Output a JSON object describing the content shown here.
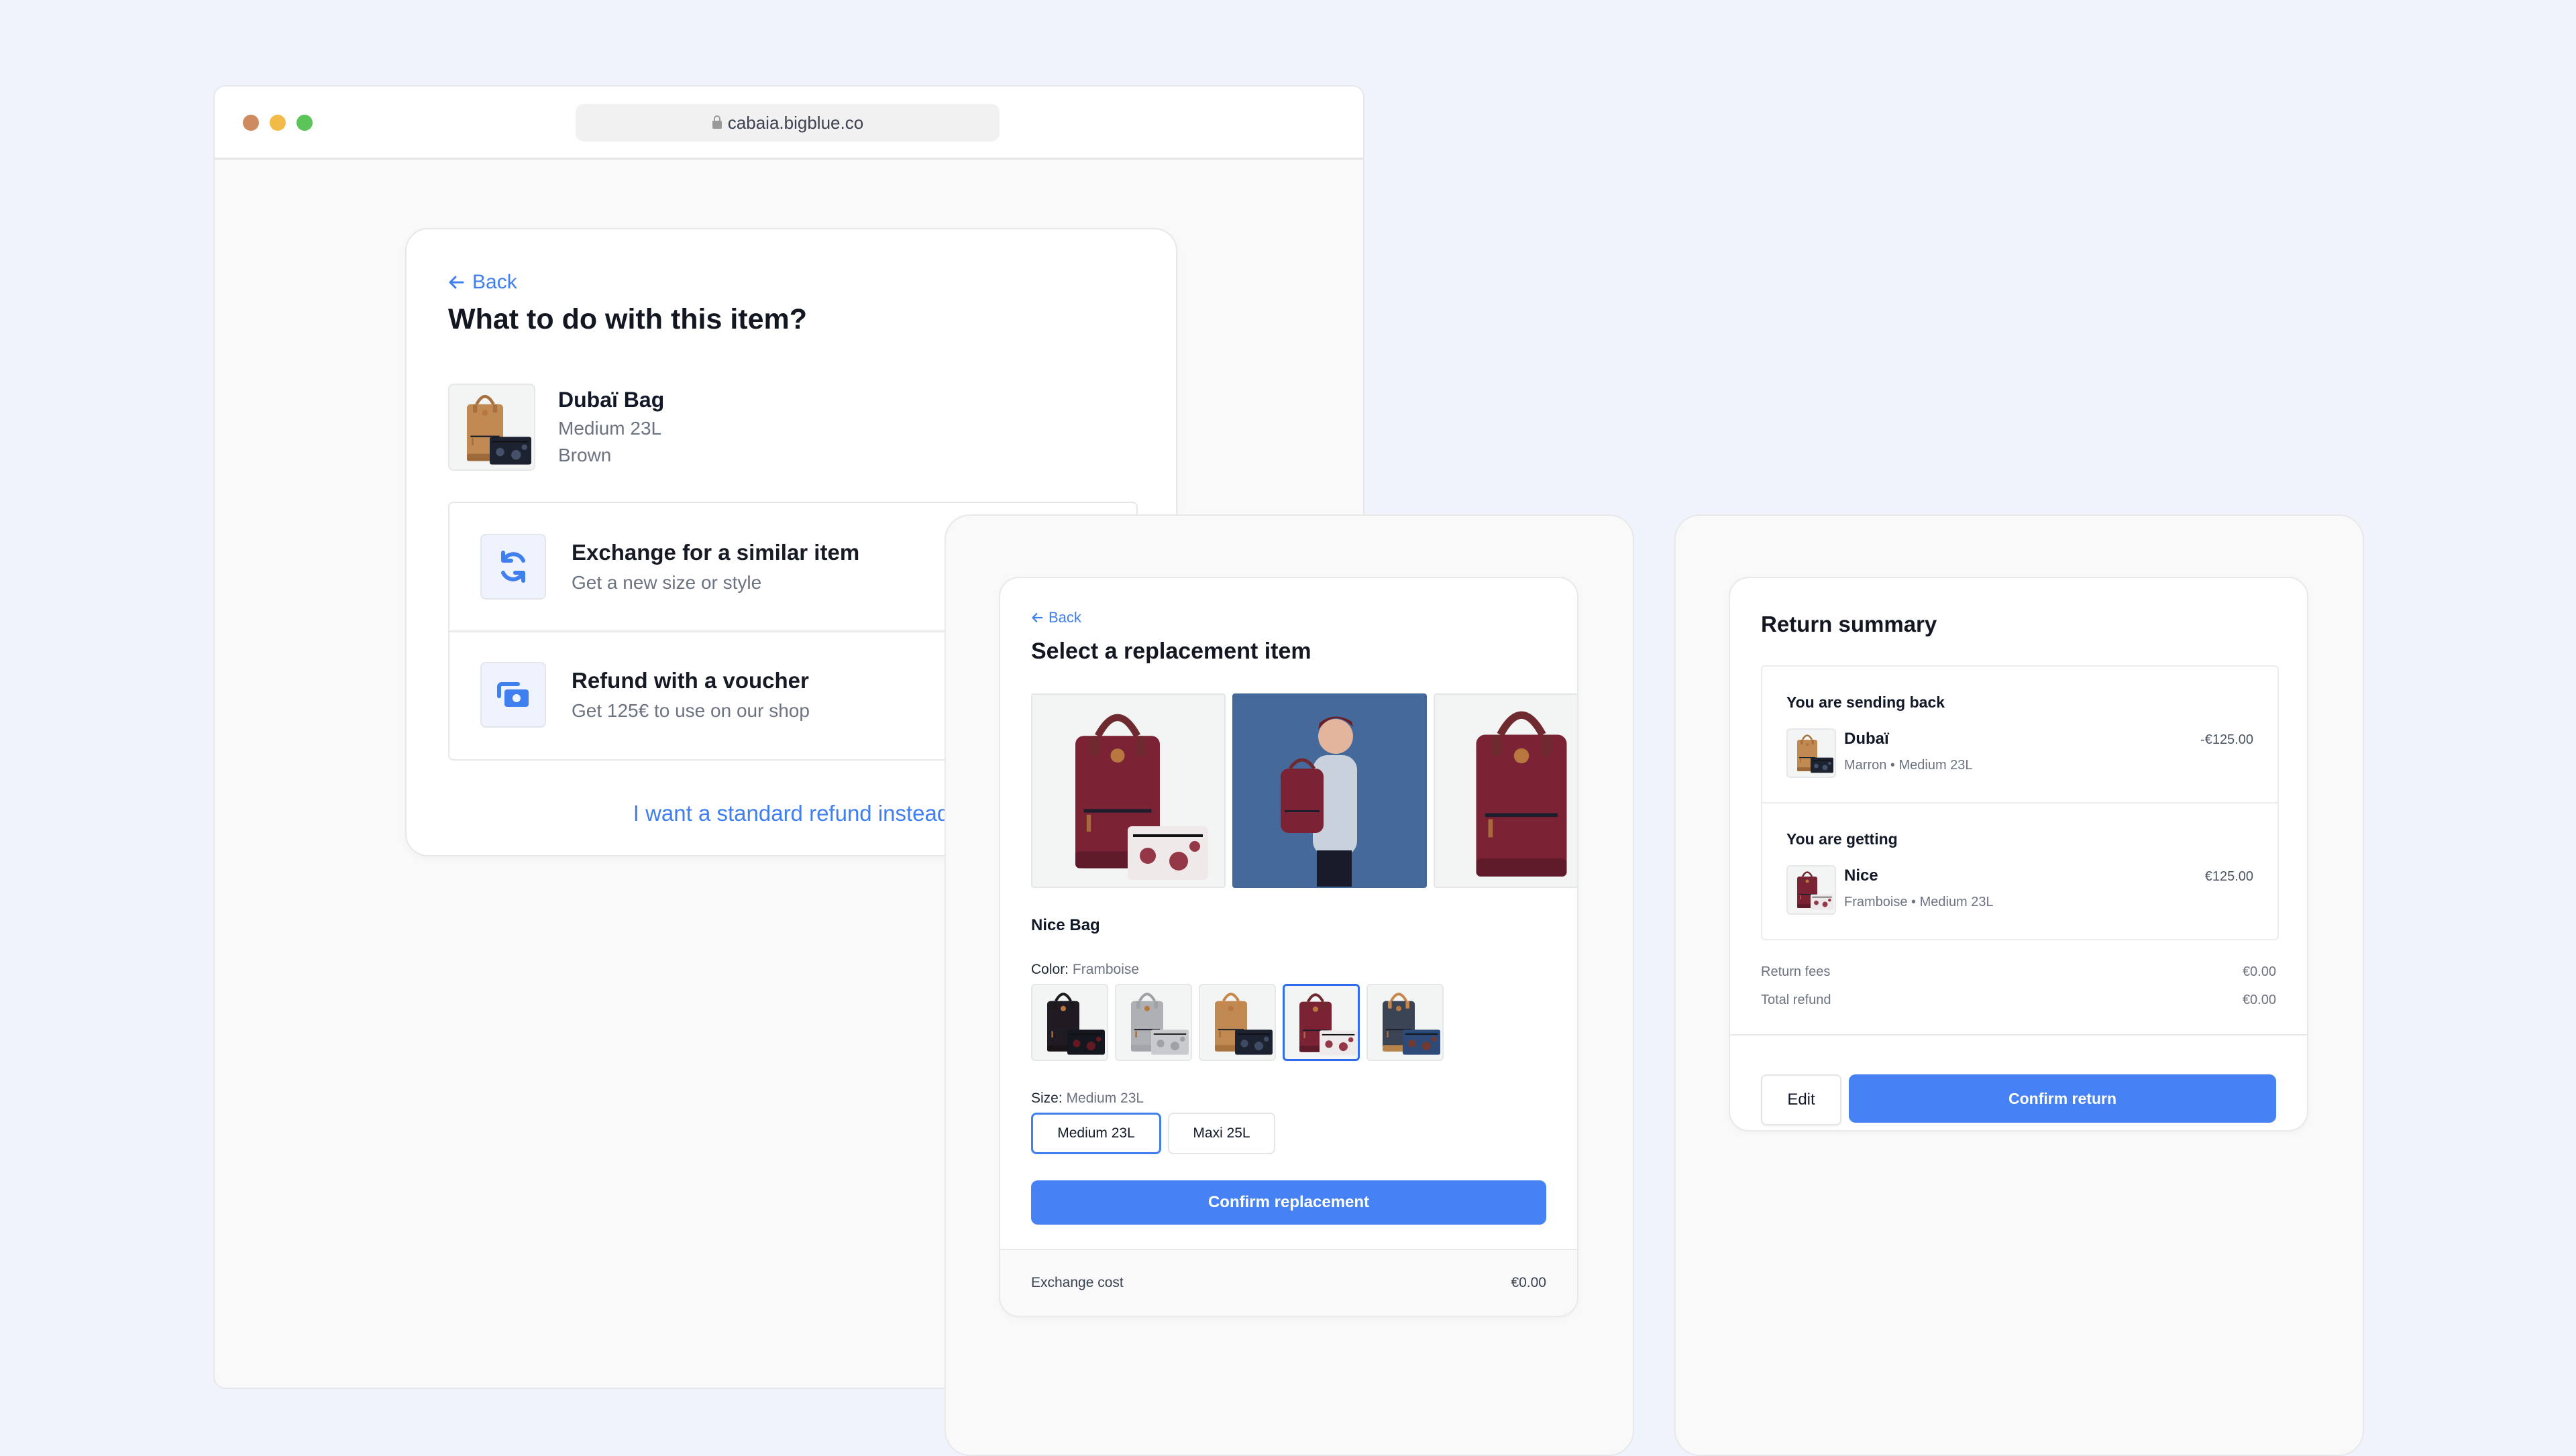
{
  "browser": {
    "url": "cabaia.bigblue.co",
    "window_controls": [
      "close",
      "minimize",
      "maximize"
    ]
  },
  "action_screen": {
    "back_label": "Back",
    "title": "What to do with this item?",
    "item": {
      "name": "Dubaï Bag",
      "size": "Medium 23L",
      "color": "Brown",
      "image": "brown-backpack-with-pouch"
    },
    "options": [
      {
        "icon": "exchange-arrows-icon",
        "title": "Exchange for a similar item",
        "subtitle": "Get a new size or style"
      },
      {
        "icon": "voucher-cash-icon",
        "title": "Refund with a voucher",
        "subtitle": "Get 125€ to use on our shop"
      }
    ],
    "standard_refund_link": "I want a standard refund instead"
  },
  "replacement_screen": {
    "back_label": "Back",
    "title": "Select a replacement item",
    "gallery": [
      "framboise-backpack-with-pouch",
      "model-wearing-backpack",
      "framboise-backpack-front"
    ],
    "product_name": "Nice Bag",
    "color_label": "Color:",
    "color_value": "Framboise",
    "color_swatches": [
      {
        "name": "black-floral",
        "selected": false
      },
      {
        "name": "grey",
        "selected": false
      },
      {
        "name": "camel",
        "selected": false
      },
      {
        "name": "framboise",
        "selected": true
      },
      {
        "name": "navy",
        "selected": false
      }
    ],
    "size_label": "Size:",
    "size_value": "Medium 23L",
    "sizes": [
      {
        "label": "Medium 23L",
        "selected": true
      },
      {
        "label": "Maxi 25L",
        "selected": false
      }
    ],
    "confirm_label": "Confirm replacement",
    "exchange_cost_label": "Exchange cost",
    "exchange_cost_value": "€0.00"
  },
  "summary_screen": {
    "title": "Return summary",
    "sending_back": {
      "heading": "You are sending back",
      "name": "Dubaï",
      "details": "Marron • Medium 23L",
      "price": "-€125.00"
    },
    "getting": {
      "heading": "You are getting",
      "name": "Nice",
      "details": "Framboise • Medium 23L",
      "price": "€125.00"
    },
    "fees": [
      {
        "label": "Return fees",
        "value": "€0.00"
      },
      {
        "label": "Total refund",
        "value": "€0.00"
      }
    ],
    "edit_label": "Edit",
    "confirm_label": "Confirm return"
  },
  "colors": {
    "background": "#eff3fb",
    "accent": "#4682f4",
    "link": "#3f7ff0",
    "selected_border": "#2f6bea"
  }
}
